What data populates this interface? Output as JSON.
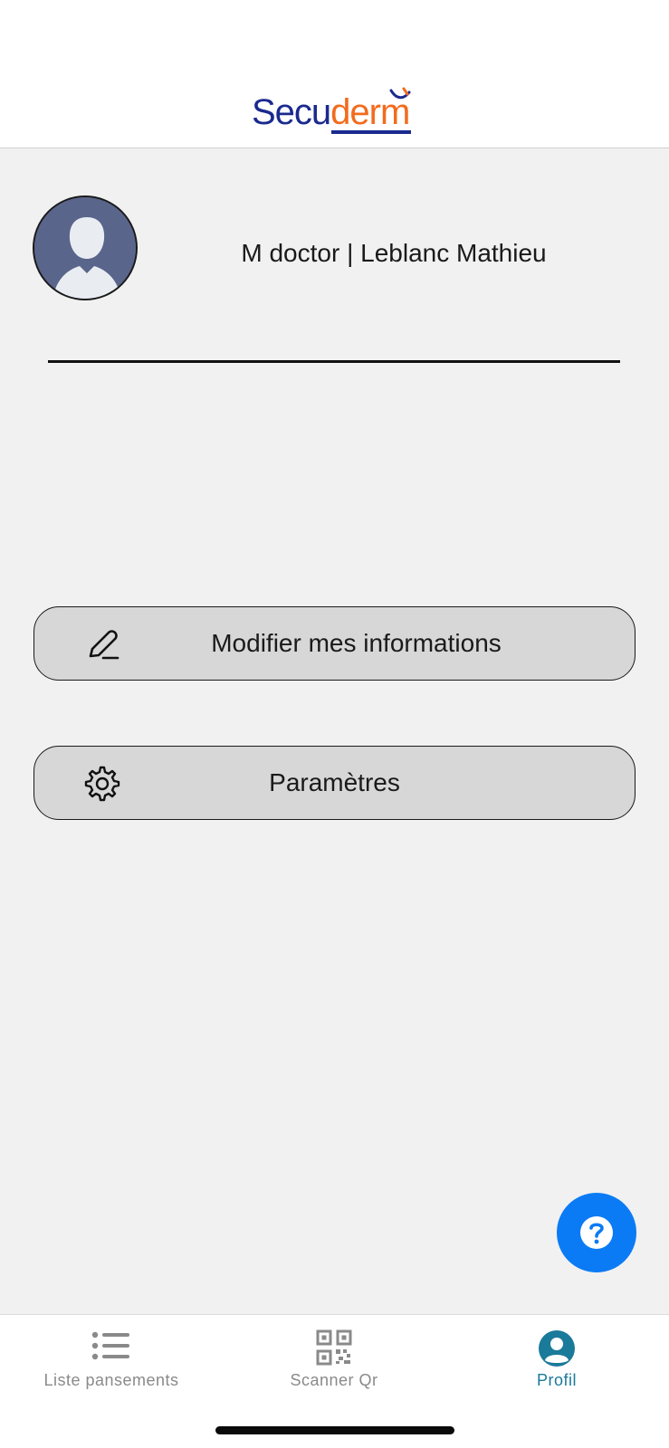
{
  "header": {
    "logo_part1": "Secu",
    "logo_part2": "derm",
    "brand_colors": {
      "primary": "#1b2a8f",
      "accent": "#f26b1d"
    }
  },
  "profile": {
    "name": "M doctor | Leblanc Mathieu",
    "avatar_icon": "default-user-avatar-icon"
  },
  "actions": {
    "modify": {
      "label": "Modifier mes informations",
      "icon": "pencil-icon"
    },
    "settings": {
      "label": "Paramètres",
      "icon": "gear-icon"
    }
  },
  "help": {
    "icon": "question-mark-icon",
    "color": "#0b7bf5"
  },
  "tabbar": {
    "tabs": [
      {
        "label": "Liste pansements",
        "icon": "list-icon",
        "active": false
      },
      {
        "label": "Scanner Qr",
        "icon": "qr-code-icon",
        "active": false
      },
      {
        "label": "Profil",
        "icon": "user-circle-icon",
        "active": true
      }
    ],
    "active_color": "#1a7a9a",
    "inactive_color": "#8a8a8a"
  }
}
